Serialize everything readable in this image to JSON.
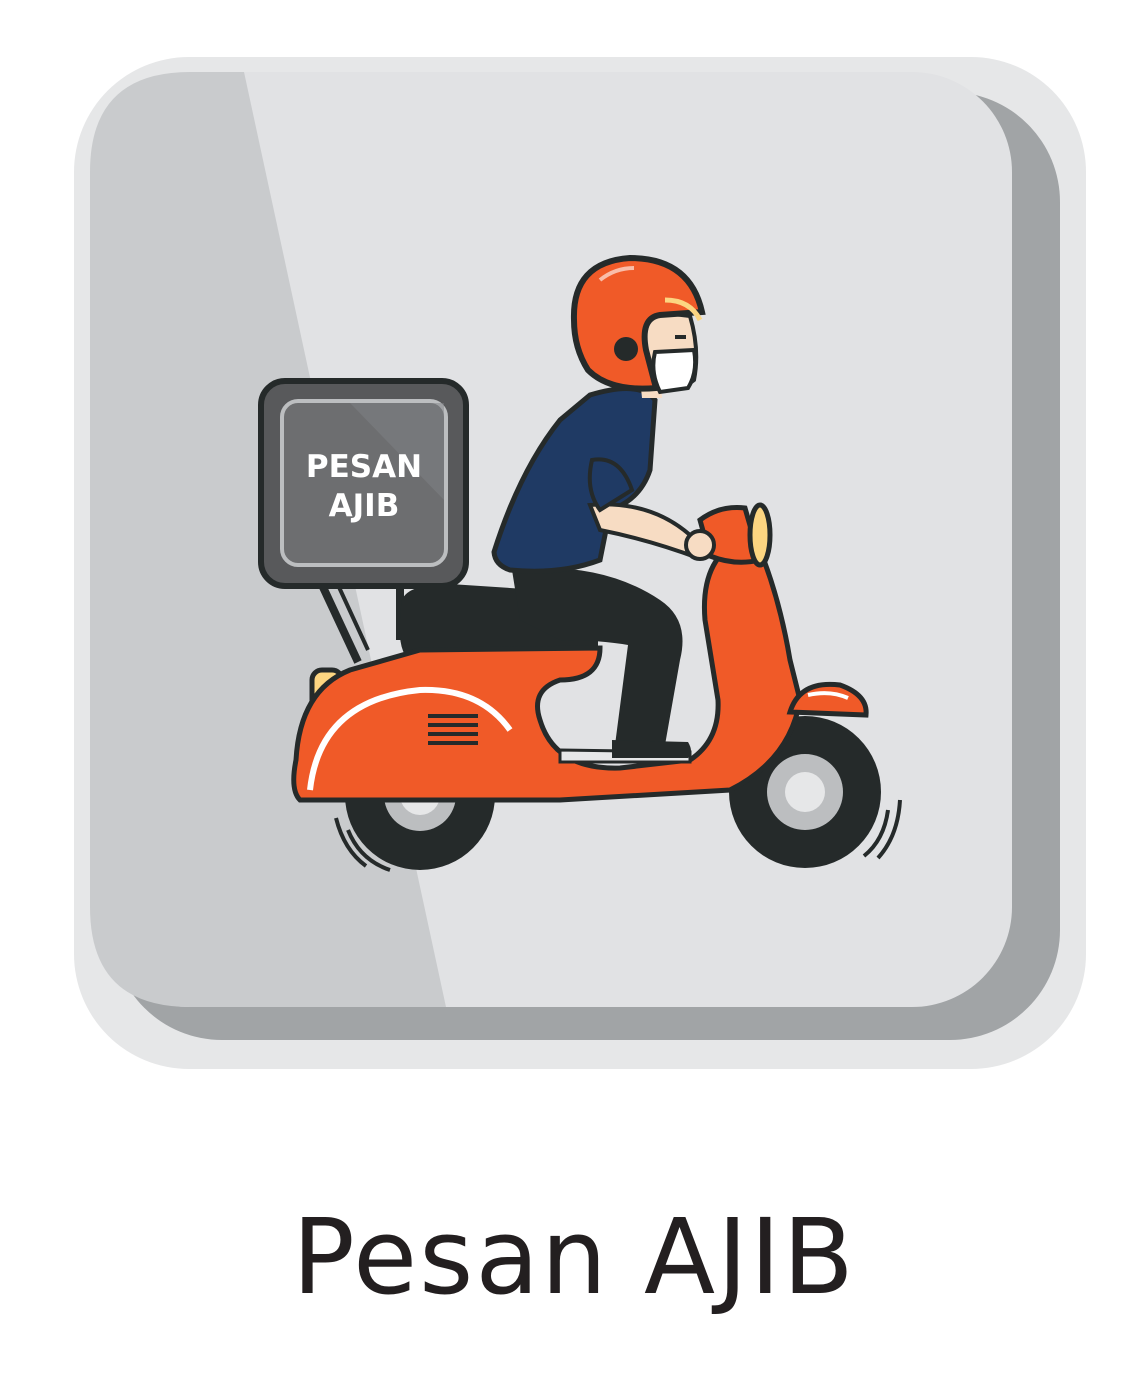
{
  "app": {
    "caption": "Pesan AJIB",
    "box_line_1": "PESAN",
    "box_line_2": "AJIB"
  },
  "icons": {
    "tile": "delivery-scooter-app-icon",
    "rider": "rider-icon",
    "scooter": "scooter-icon",
    "delivery_box": "delivery-box-icon"
  },
  "colors": {
    "tile_face": "#e1e2e4",
    "tile_shadow": "#a1a4a6",
    "scooter_orange": "#f05a28",
    "helmet_orange": "#f05a28",
    "shirt_blue": "#1f3a64",
    "box_gray": "#6d6e70",
    "outline": "#252a2a",
    "caption_text": "#231f20"
  }
}
